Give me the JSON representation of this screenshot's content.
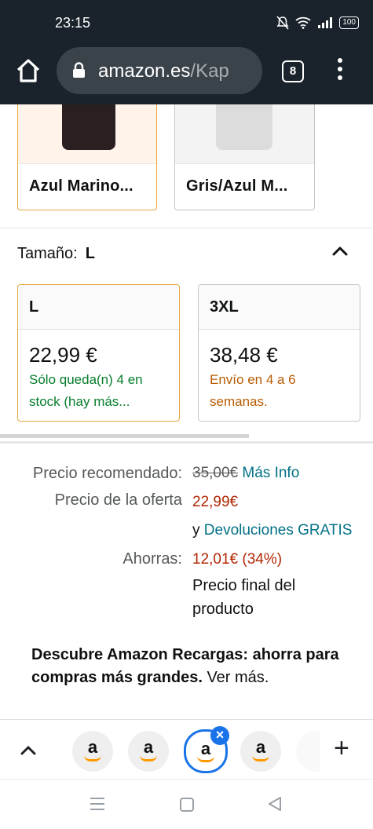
{
  "status_bar": {
    "time": "23:15",
    "battery": "100"
  },
  "browser": {
    "url_host": "amazon.es",
    "url_path": "/Kap",
    "tab_count": "8"
  },
  "color_options": [
    {
      "label": "Azul Marino...",
      "selected": true
    },
    {
      "label": "Gris/Azul M...",
      "selected": false
    }
  ],
  "size": {
    "label": "Tamaño:",
    "value": "L"
  },
  "size_options": [
    {
      "size": "L",
      "price": "22,99 €",
      "note": "Sólo queda(n) 4 en stock (hay más...",
      "selected": true
    },
    {
      "size": "3XL",
      "price": "38,48 €",
      "note": "Envío en 4 a 6 semanas.",
      "selected": false
    }
  ],
  "pricing": {
    "recommended_label": "Precio recomendado:",
    "recommended_value": "35,00€",
    "more_info": "Más Info",
    "offer_label": "Precio de la oferta",
    "offer_value": "22,99€",
    "returns_prefix": "y",
    "returns_link": "Devoluciones GRATIS",
    "savings_label": "Ahorras:",
    "savings_value": "12,01€ (34%)",
    "final_line1": "Precio final del",
    "final_line2": "producto"
  },
  "promo": {
    "bold": "Descubre Amazon Recargas: ahorra para compras más grandes.",
    "link": "Ver más."
  },
  "tab_strip": {
    "tab_letter": "a"
  },
  "colors": {
    "accent_border": "#e3a73a",
    "price_red": "#b12704",
    "link_teal": "#007185",
    "stock_green": "#067d2c",
    "ship_orange": "#b85c00"
  }
}
